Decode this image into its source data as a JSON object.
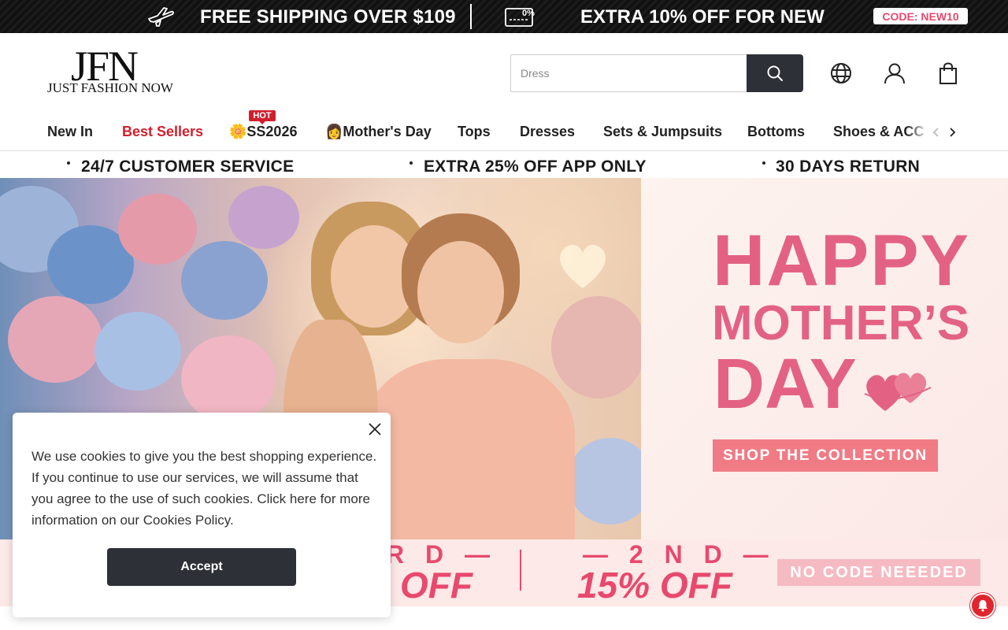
{
  "promo_bar": {
    "shipping_text": "FREE SHIPPING OVER $109",
    "coupon_icon_label": "0%",
    "extra_text": "EXTRA 10% OFF FOR NEW",
    "code_text": "CODE: NEW10"
  },
  "header": {
    "logo_main": "JFN",
    "logo_sub": "JUST FASHION NOW",
    "search": {
      "placeholder": "Dress",
      "value": ""
    },
    "icons": [
      "search-icon",
      "globe-icon",
      "user-icon",
      "bag-icon"
    ]
  },
  "nav": {
    "items": [
      {
        "label": "New In",
        "highlight": false
      },
      {
        "label": "Best Sellers",
        "highlight": true
      },
      {
        "label": "🌼SS2026",
        "badge": "HOT"
      },
      {
        "label": "👩Mother's Day"
      },
      {
        "label": "Tops"
      },
      {
        "label": "Dresses"
      },
      {
        "label": "Sets & Jumpsuits"
      },
      {
        "label": "Bottoms"
      },
      {
        "label": "Shoes & ACC"
      }
    ]
  },
  "service_strip": {
    "items": [
      "24/7 CUSTOMER SERVICE",
      "EXTRA 25% OFF APP ONLY",
      "30 DAYS RETURN"
    ]
  },
  "hero": {
    "line1": "HAPPY",
    "line2": "MOTHER’S",
    "line3": "DAY",
    "cta": "SHOP THE COLLECTION"
  },
  "promo_strip": {
    "first_heading": "— 3RD —",
    "first_visible_heading": "R D —",
    "first_offer": "OFF",
    "second_heading": "— 2 N D —",
    "second_offer": "15% OFF",
    "no_code": "NO CODE NEEEDED"
  },
  "cookie": {
    "text": "We use cookies to give you the best shopping experience. If you continue to use our services, we will assume that you agree to the use of such cookies. Click here for more information on our Cookies Policy.",
    "accept_label": "Accept"
  },
  "colors": {
    "accent_pink": "#e36283",
    "promo_red": "#e8496e",
    "dark_button": "#2d3036",
    "nav_red": "#d0202e"
  }
}
